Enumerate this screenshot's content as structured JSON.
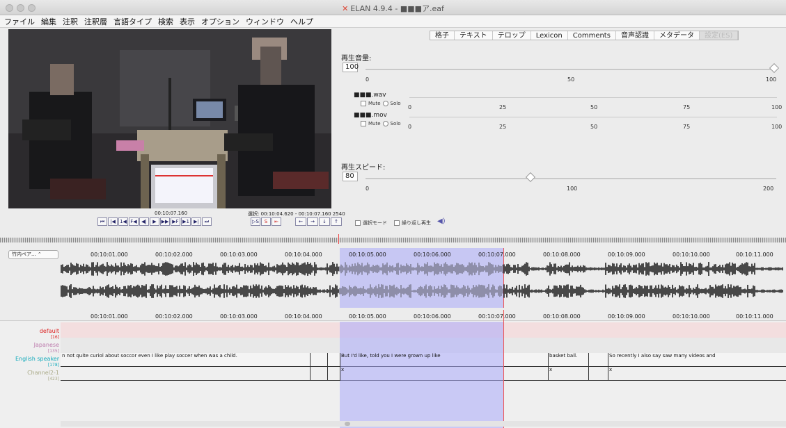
{
  "window": {
    "title": "ELAN 4.9.4 - ■■■ア.eaf"
  },
  "menu": [
    "ファイル",
    "編集",
    "注釈",
    "注釈層",
    "言語タイプ",
    "検索",
    "表示",
    "オプション",
    "ウィンドウ",
    "ヘルプ"
  ],
  "tabs": [
    "格子",
    "テキスト",
    "テロップ",
    "Lexicon",
    "Comments",
    "音声認識",
    "メタデータ",
    "設定(ES)"
  ],
  "volume": {
    "label": "再生音量:",
    "value": "100",
    "ticks": [
      "0",
      "50",
      "100"
    ],
    "level": 100
  },
  "tracks": [
    {
      "name": "■■■.wav",
      "mute": "Mute",
      "solo": "Solo",
      "ticks": [
        "0",
        "25",
        "50",
        "75",
        "100"
      ],
      "level": 100
    },
    {
      "name": "■■■.mov",
      "mute": "Mute",
      "solo": "Solo",
      "ticks": [
        "0",
        "25",
        "50",
        "75",
        "100"
      ],
      "level": 0
    }
  ],
  "speed": {
    "label": "再生スピード:",
    "value": "80",
    "ticks": [
      "0",
      "100",
      "200"
    ],
    "level": 80
  },
  "player": {
    "current_time": "00:10:07.160",
    "selection": "選択: 00:10:04.620 - 00:10:07.160 2540",
    "select_mode": "選択モード",
    "loop_mode": "繰り返し再生"
  },
  "waveform": {
    "track_selector": "竹内ペア...",
    "time_labels": [
      "00:10:01.000",
      "00:10:02.000",
      "00:10:03.000",
      "00:10:04.000",
      "00:10:05.000",
      "00:10:06.000",
      "00:10:07.000",
      "00:10:08.000",
      "00:10:09.000",
      "00:10:10.000",
      "00:10:11.000"
    ]
  },
  "timeline": {
    "time_labels": [
      "00:10:01.000",
      "00:10:02.000",
      "00:10:03.000",
      "00:10:04.000",
      "00:10:05.000",
      "00:10:06.000",
      "00:10:07.000",
      "00:10:08.000",
      "00:10:09.000",
      "00:10:10.000",
      "00:10:11.000"
    ],
    "tiers": [
      {
        "name": "default",
        "count": "[16]",
        "color": "#d22"
      },
      {
        "name": "Japanese",
        "count": "[135]",
        "color": "#b7a"
      },
      {
        "name": "English speaker",
        "count": "[178]",
        "color": "#1ab"
      },
      {
        "name": "Channel2-1",
        "count": "[423]",
        "color": "#aa8"
      }
    ],
    "english_annotations": [
      "n not quite curiol about soccor even I like play soccer when was a child.",
      "But I'd like, told you I were grown up like",
      "basket ball.",
      "So recently I also say saw many videos and"
    ],
    "channel_annotations": [
      "x",
      "x",
      "x"
    ]
  },
  "colors": {
    "selection": "#aaaafa",
    "crosshair": "#e55555"
  }
}
